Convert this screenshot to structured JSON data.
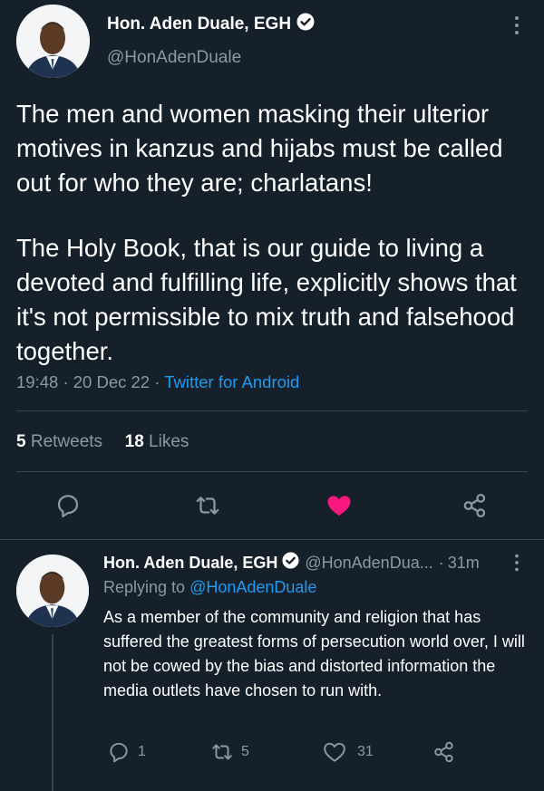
{
  "tweet": {
    "author_name": "Hon. Aden Duale, EGH",
    "author_handle": "@HonAdenDuale",
    "more_icon": "more-vertical-icon",
    "paragraph1": "The men and women masking their ulterior motives in kanzus and hijabs must be called out for who they are; charlatans!",
    "paragraph2": "The Holy Book, that is our guide to living a devoted and fulfilling life, explicitly shows that it's not permissible to mix truth and falsehood together.",
    "time": "19:48",
    "date": "20 Dec 22",
    "separator": "·",
    "source": "Twitter for Android",
    "retweets_count": "5",
    "retweets_label": "Retweets",
    "likes_count": "18",
    "likes_label": "Likes",
    "actions": [
      "reply-icon",
      "retweet-icon",
      "like-icon",
      "share-icon"
    ]
  },
  "reply": {
    "author_name": "Hon. Aden Duale, EGH",
    "author_handle": "@HonAdenDua...",
    "time_ago": "31m",
    "replying_to_label": "Replying to",
    "replying_to_handle": "@HonAdenDuale",
    "text": "As a member of the community and religion that has suffered the greatest forms of persecution world over, I will not be cowed by the bias and distorted information the media outlets have chosen to run with.",
    "reply_count": "1",
    "retweet_count": "5",
    "like_count": "31"
  },
  "colors": {
    "background": "#15202b",
    "secondary_text": "#8b98a5",
    "link": "#1d9bf0",
    "like": "#f91880",
    "divider": "#38444d"
  }
}
